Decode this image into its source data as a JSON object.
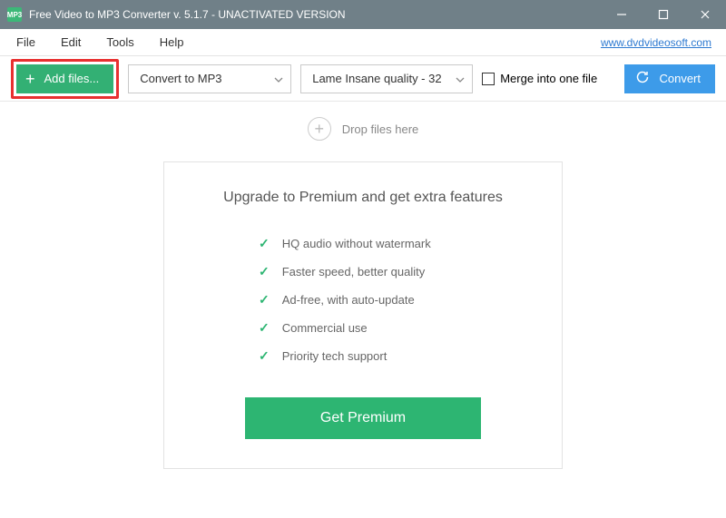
{
  "titlebar": {
    "title": "Free Video to MP3 Converter v. 5.1.7 - UNACTIVATED VERSION"
  },
  "menubar": {
    "file": "File",
    "edit": "Edit",
    "tools": "Tools",
    "help": "Help",
    "link": "www.dvdvideosoft.com"
  },
  "toolbar": {
    "add_files": "Add files...",
    "format_selected": "Convert to MP3",
    "quality_selected": "Lame Insane quality - 32",
    "merge_label": "Merge into one file",
    "convert": "Convert"
  },
  "dropzone": {
    "text": "Drop files here"
  },
  "premium": {
    "heading": "Upgrade to Premium and get extra features",
    "features": [
      "HQ audio without watermark",
      "Faster speed, better quality",
      "Ad-free, with auto-update",
      "Commercial use",
      "Priority tech support"
    ],
    "button": "Get Premium"
  }
}
